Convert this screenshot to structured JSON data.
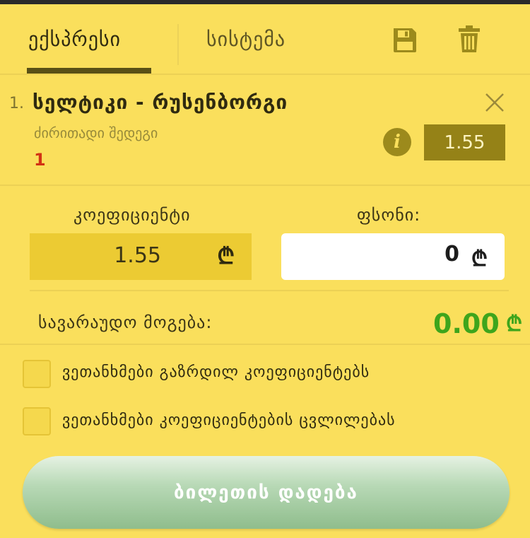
{
  "tabs": {
    "express": "ექსპრესი",
    "system": "სისტემა"
  },
  "icons": {
    "save": "save-icon",
    "trash": "trash-icon",
    "close": "close-icon",
    "info": "info-icon"
  },
  "bet": {
    "index": "1.",
    "title": "სელტიკი - რუსენბორგი",
    "market": "ძირითადი შედეგი",
    "selection": "1",
    "odds": "1.55",
    "info_glyph": "i"
  },
  "stake": {
    "coef_label": "კოეფიციენტი",
    "coef_value": "1.55",
    "stake_label": "ფსონი:",
    "stake_value": "0",
    "currency": "₾",
    "winnings_label": "სავარაუდო მოგება:",
    "winnings_value": "0.00"
  },
  "options": [
    {
      "label": "ვეთანხმები გაზრდილ კოეფიციენტებს"
    },
    {
      "label": "ვეთანხმები კოეფიციენტების ცვლილებას"
    }
  ],
  "action": {
    "place_bet": "ბილეთის დადება"
  },
  "colors": {
    "background": "#fadf5c",
    "accent_dark": "#958217",
    "win_green": "#3ea51c",
    "selection_red": "#d23214"
  }
}
